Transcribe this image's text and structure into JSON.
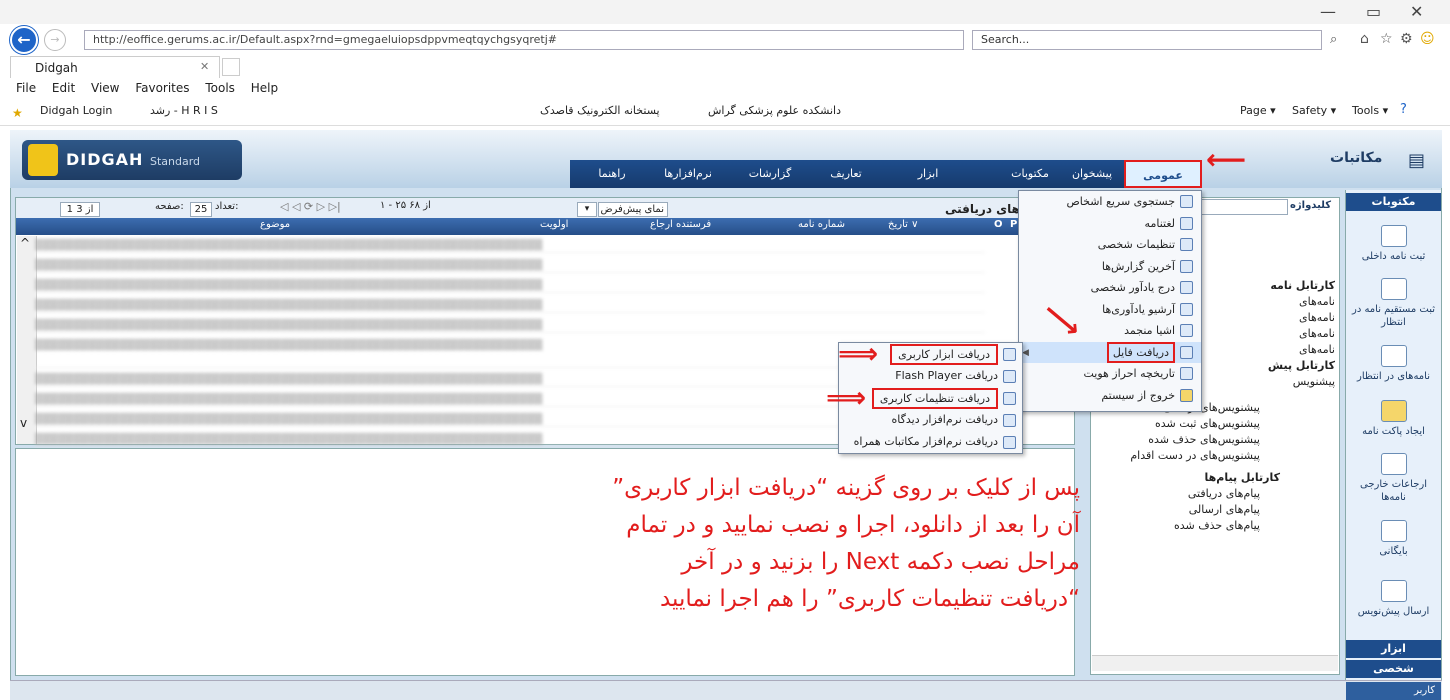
{
  "browser": {
    "url": "http://eoffice.gerums.ac.ir/Default.aspx?rnd=gmegaeluiopsdppvmeqtqychgsyqretj#",
    "search_placeholder": "Search...",
    "tab_title": "Didgah",
    "menu": [
      "File",
      "Edit",
      "View",
      "Favorites",
      "Tools",
      "Help"
    ],
    "favorites": [
      "رشد - H R I S",
      "Didgah Login"
    ],
    "favorites_center": [
      "دانشکده علوم پزشکی گراش",
      "پستخانه الکترونیک قاصدک"
    ],
    "command_bar": [
      "Page ▾",
      "Safety ▾",
      "Tools ▾"
    ]
  },
  "app": {
    "logo_text": "DIDGAH",
    "logo_sub": "Standard",
    "title": "مکاتبات",
    "nav": [
      "عمومی",
      "پیشخوان",
      "مکتوبات",
      "ابزار",
      "تعاریف",
      "گزارشات",
      "نرم‌افزارها",
      "راهنما"
    ],
    "right_panel": {
      "header": "مکتوبات",
      "items": [
        "ثبت نامه داخلی",
        "ثبت مستقیم نامه در انتظار",
        "نامه‌های در انتظار",
        "ایجاد پاکت نامه",
        "ارجاعات خارجی نامه‌ها",
        "بایگانی",
        "ارسال پیش‌نویس"
      ],
      "footer1": "ابزار",
      "footer2": "شخصی",
      "footer3": "کاربر"
    }
  },
  "grid": {
    "title": "های دریافتی",
    "view_select": "نمای پیش‌فرض",
    "paging": "۱ - ۲۵ از ۶۸",
    "count_label": "تعداد:",
    "count_value": "25",
    "page_label": "صفحه:",
    "page_value": "1 از 3",
    "columns": [
      "P",
      "O",
      "تاریخ ∨",
      "شماره نامه",
      "فرستنده ارجاع",
      "اولویت",
      "موضوع"
    ]
  },
  "keyword_label": "کلیدواژه",
  "menu": {
    "items": [
      "جستجوی سریع اشخاص",
      "لغتنامه",
      "تنظیمات شخصی",
      "آخرین گزارش‌ها",
      "درج یادآور شخصی",
      "آرشیو یادآوری‌ها",
      "اشیا منجمد",
      "دریافت فایل",
      "تاریخچه احراز هویت",
      "خروج از سیستم"
    ]
  },
  "submenu": {
    "items": [
      "دریافت ابزار کاربری",
      "دریافت Flash Player",
      "دریافت تنظیمات کاربری",
      "دریافت نرم‌افزار دیدگاه",
      "دریافت نرم‌افزار مکاتبات همراه"
    ]
  },
  "tree": {
    "nodes": [
      "کارتابل نامه",
      "نامه‌های",
      "نامه‌های",
      "نامه‌های",
      "نامه‌های",
      "کارتابل پیش",
      "پیشنویس",
      "پیشنویس‌های ارسالی",
      "پیشنویس‌های ثبت شده",
      "پیشنویس‌های حذف شده",
      "پیشنویس‌های در دست اقدام",
      "کارتابل پیام‌ها",
      "پیام‌های دریافتی",
      "پیام‌های ارسالی",
      "پیام‌های حذف شده"
    ]
  },
  "instruction": "پس از کلیک بر روی گزینه “دریافت ابزار کاربری” آن را بعد از دانلود، اجرا و نصب نمایید و در تمام مراحل نصب دکمه Next را بزنید و در آخر “دریافت تنظیمات کاربری” را هم اجرا نمایید",
  "colors": {
    "nav_bar": "#1e4d8c",
    "highlight": "#e21d1d",
    "instruction_text": "#e21d1d"
  }
}
